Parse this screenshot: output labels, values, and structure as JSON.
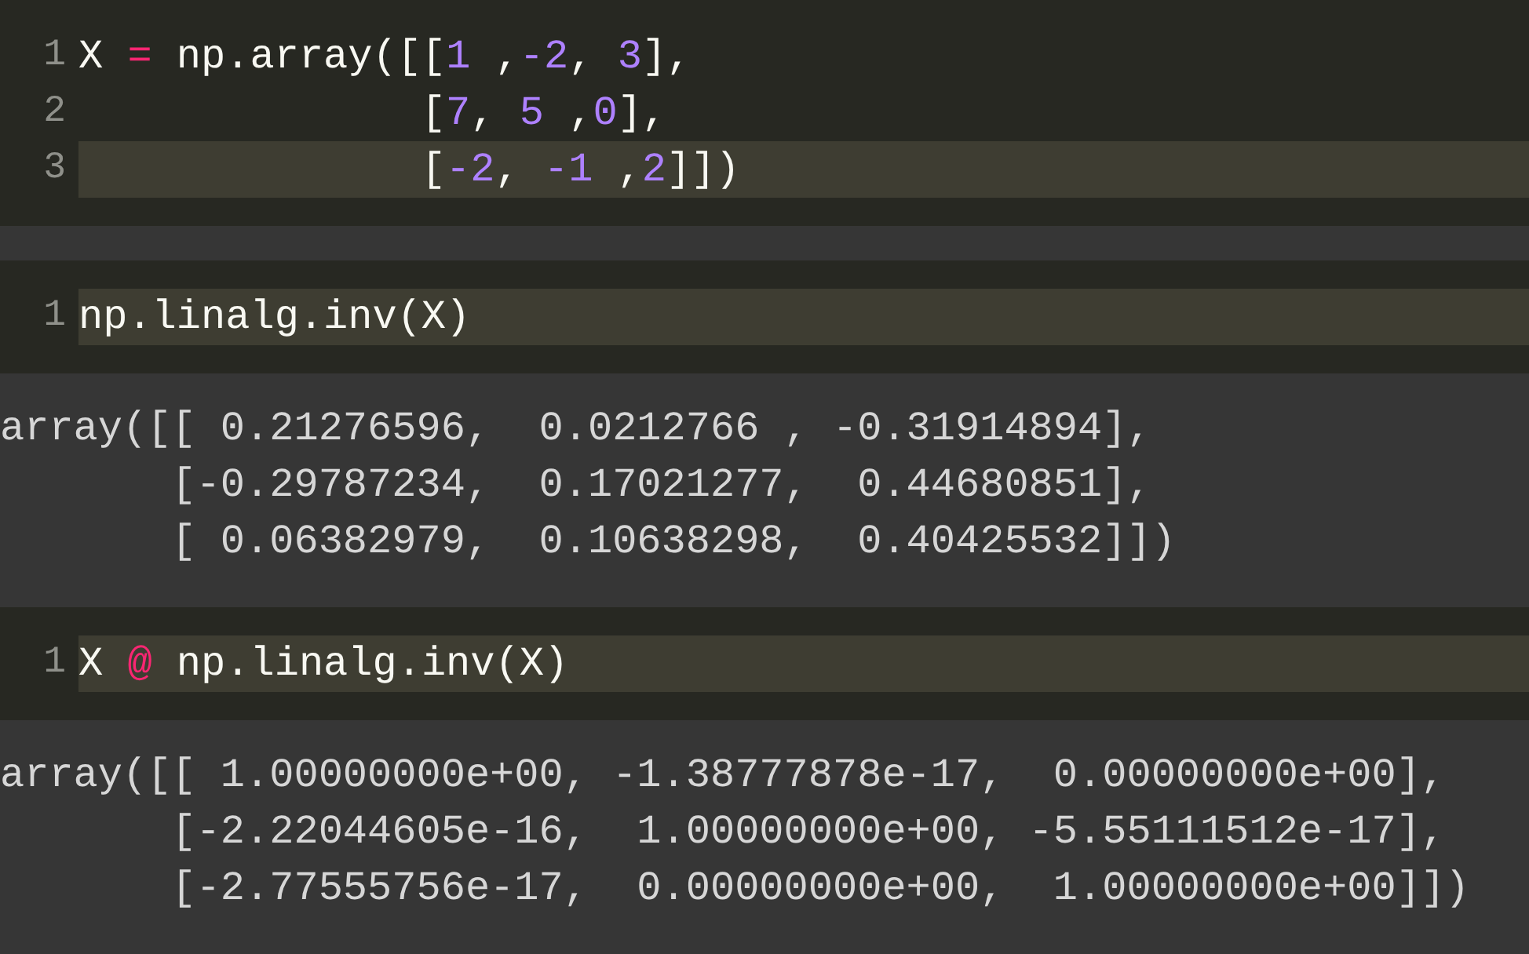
{
  "cells": [
    {
      "input_lines": [
        {
          "number": "1",
          "active": false,
          "tokens": [
            {
              "kind": "plain",
              "text": "X "
            },
            {
              "kind": "operator",
              "text": "="
            },
            {
              "kind": "plain",
              "text": " np.array([["
            },
            {
              "kind": "number",
              "text": "1"
            },
            {
              "kind": "plain",
              "text": " ,"
            },
            {
              "kind": "number",
              "text": "-2"
            },
            {
              "kind": "plain",
              "text": ", "
            },
            {
              "kind": "number",
              "text": "3"
            },
            {
              "kind": "plain",
              "text": "],"
            }
          ]
        },
        {
          "number": "2",
          "active": false,
          "tokens": [
            {
              "kind": "plain",
              "text": "              ["
            },
            {
              "kind": "number",
              "text": "7"
            },
            {
              "kind": "plain",
              "text": ", "
            },
            {
              "kind": "number",
              "text": "5"
            },
            {
              "kind": "plain",
              "text": " ,"
            },
            {
              "kind": "number",
              "text": "0"
            },
            {
              "kind": "plain",
              "text": "],"
            }
          ]
        },
        {
          "number": "3",
          "active": true,
          "tokens": [
            {
              "kind": "plain",
              "text": "              ["
            },
            {
              "kind": "number",
              "text": "-2"
            },
            {
              "kind": "plain",
              "text": ", "
            },
            {
              "kind": "number",
              "text": "-1"
            },
            {
              "kind": "plain",
              "text": " ,"
            },
            {
              "kind": "number",
              "text": "2"
            },
            {
              "kind": "plain",
              "text": "]])"
            }
          ]
        }
      ]
    },
    {
      "input_lines": [
        {
          "number": "1",
          "active": true,
          "tokens": [
            {
              "kind": "plain",
              "text": "np.linalg.inv(X)"
            }
          ]
        }
      ],
      "output_lines": [
        "array([[ 0.21276596,  0.0212766 , -0.31914894],",
        "       [-0.29787234,  0.17021277,  0.44680851],",
        "       [ 0.06382979,  0.10638298,  0.40425532]])"
      ]
    },
    {
      "input_lines": [
        {
          "number": "1",
          "active": true,
          "tokens": [
            {
              "kind": "plain",
              "text": "X "
            },
            {
              "kind": "operator",
              "text": "@"
            },
            {
              "kind": "plain",
              "text": " np.linalg.inv(X)"
            }
          ]
        }
      ],
      "output_lines": [
        "array([[ 1.00000000e+00, -1.38777878e-17,  0.00000000e+00],",
        "       [-2.22044605e-16,  1.00000000e+00, -5.55111512e-17],",
        "       [-2.77555756e-17,  0.00000000e+00,  1.00000000e+00]])"
      ]
    }
  ]
}
